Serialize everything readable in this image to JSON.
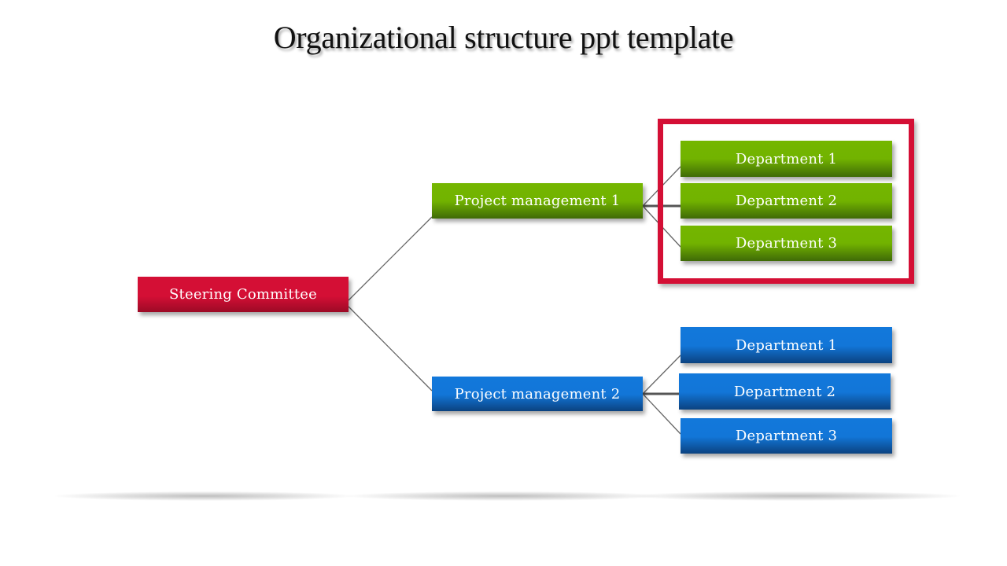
{
  "title": "Organizational structure ppt template",
  "colors": {
    "root": "#d40f35",
    "branch_1": "#74b600",
    "branch_2": "#1278db",
    "highlight_frame": "#d40f35",
    "connector": "#666666"
  },
  "org_chart": {
    "root": {
      "label": "Steering Committee"
    },
    "branches": [
      {
        "label": "Project management 1",
        "color": "green",
        "highlighted": true,
        "children": [
          {
            "label": "Department 1"
          },
          {
            "label": "Department 2"
          },
          {
            "label": "Department 3"
          }
        ]
      },
      {
        "label": "Project management 2",
        "color": "blue",
        "highlighted": false,
        "children": [
          {
            "label": "Department 1"
          },
          {
            "label": "Department 2"
          },
          {
            "label": "Department 3"
          }
        ]
      }
    ]
  }
}
